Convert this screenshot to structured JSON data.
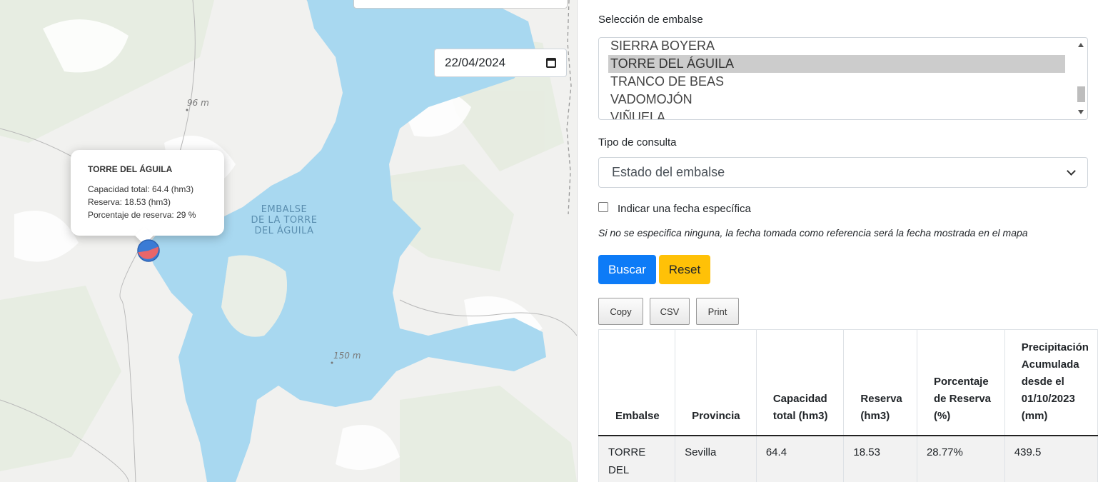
{
  "map": {
    "date_value": "22/04/2024",
    "elevations": [
      "96 m",
      "150 m"
    ],
    "lake_label_lines": [
      "EMBALSE",
      "DE LA TORRE",
      "DEL ÁGUILA"
    ],
    "water_color": "#a8d8f0",
    "popup": {
      "title": "TORRE DEL ÁGUILA",
      "lines": [
        "Capacidad total: 64.4 (hm3)",
        "Reserva: 18.53 (hm3)",
        "Porcentaje de reserva: 29 %"
      ]
    },
    "marker": {
      "reserve_fraction": 0.29,
      "fill_color": "#e8666a",
      "empty_color": "#3a7bd5"
    }
  },
  "panel": {
    "reservoir_label": "Selección de embalse",
    "reservoir_options": [
      "SIERRA BOYERA",
      "TORRE DEL ÁGUILA",
      "TRANCO DE BEAS",
      "VADOMOJÓN",
      "VIÑUELA"
    ],
    "reservoir_selected": "TORRE DEL ÁGUILA",
    "query_label": "Tipo de consulta",
    "query_value": "Estado del embalse",
    "date_checkbox_label": "Indicar una fecha específica",
    "date_checkbox_checked": false,
    "note": "Si no se especifica ninguna, la fecha tomada como referencia será la fecha mostrada en el mapa",
    "buttons": {
      "search": "Buscar",
      "reset": "Reset"
    },
    "export_buttons": [
      "Copy",
      "CSV",
      "Print"
    ],
    "colors": {
      "primary": "#0d7bf7",
      "warning": "#ffc107"
    },
    "table": {
      "headers": [
        "Embalse",
        "Provincia",
        "Capacidad total (hm3)",
        "Reserva (hm3)",
        "Porcentaje de Reserva (%)",
        "Precipitación Acumulada desde el 01/10/2023 (mm)"
      ],
      "rows": [
        [
          "TORRE DEL ÁGUILA",
          "Sevilla",
          "64.4",
          "18.53",
          "28.77%",
          "439.5"
        ]
      ]
    }
  }
}
